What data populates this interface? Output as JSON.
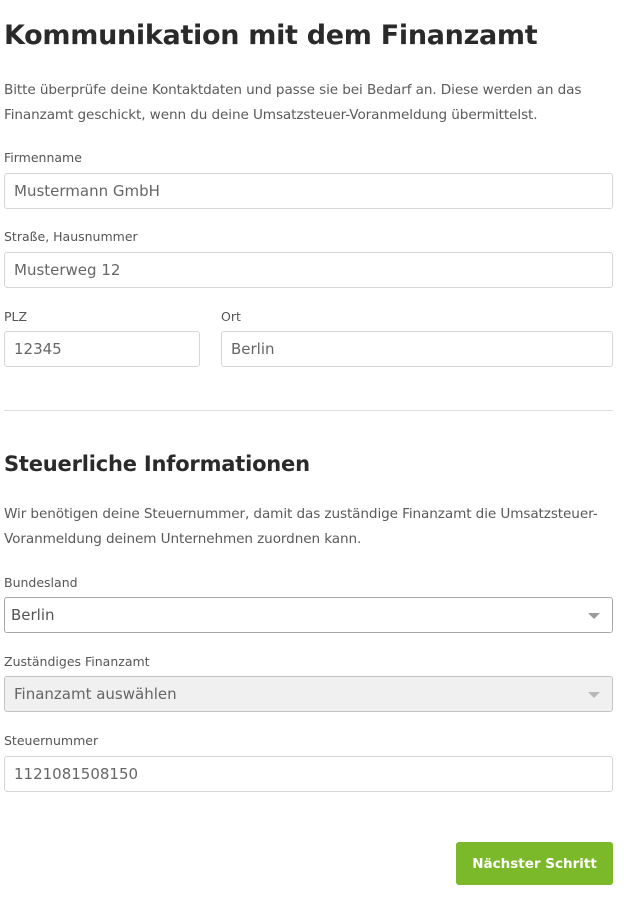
{
  "contact": {
    "title": "Kommunikation mit dem Finanzamt",
    "intro": "Bitte überprüfe deine Kontaktdaten und passe sie bei Bedarf an. Diese werden an das Finanzamt geschickt, wenn du deine Umsatzsteuer-Voranmeldung übermittelst.",
    "company_label": "Firmenname",
    "company_value": "Mustermann GmbH",
    "street_label": "Straße, Hausnummer",
    "street_value": "Musterweg 12",
    "zip_label": "PLZ",
    "zip_value": "12345",
    "city_label": "Ort",
    "city_value": "Berlin"
  },
  "tax": {
    "title": "Steuerliche Informationen",
    "intro": "Wir benötigen deine Steuernummer, damit das zuständige Finanzamt die Umsatzsteuer-Voranmeldung deinem Unternehmen zuordnen kann.",
    "state_label": "Bundesland",
    "state_value": "Berlin",
    "office_label": "Zuständiges Finanzamt",
    "office_value": "Finanzamt auswählen",
    "taxnumber_label": "Steuernummer",
    "taxnumber_value": "1121081508150"
  },
  "actions": {
    "next_label": "Nächster Schritt"
  },
  "colors": {
    "primary_button": "#7cb92a"
  }
}
